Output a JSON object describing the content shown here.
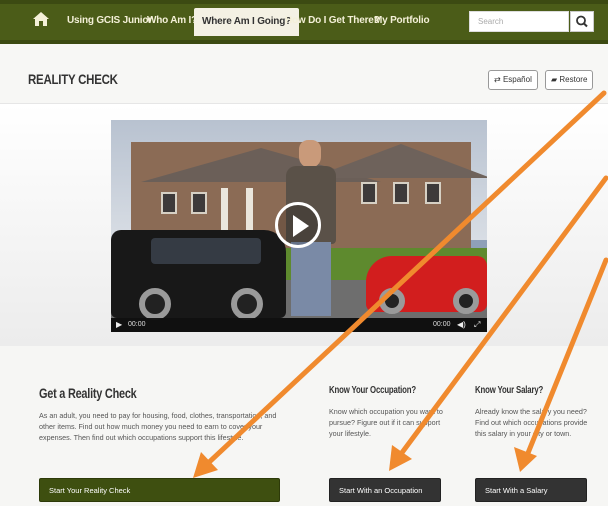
{
  "nav": {
    "items": [
      {
        "label": "Using GCIS Junior"
      },
      {
        "label": "Who Am I?"
      },
      {
        "label": "Where Am I Going?"
      },
      {
        "label": "How Do I Get There?"
      },
      {
        "label": "My Portfolio"
      }
    ],
    "active_index": 2,
    "search_placeholder": "Search"
  },
  "header": {
    "title": "REALITY CHECK",
    "espanol_label": "Español",
    "restore_label": "Restore"
  },
  "video": {
    "current_time": "00:00",
    "duration": "00:00"
  },
  "reality": {
    "heading": "Get a Reality Check",
    "body": "As an adult, you need to pay for housing, food, clothes, transportation, and other items. Find out how much money you need to earn to cover your expenses. Then find out which occupations support this lifestyle.",
    "button": "Start Your Reality Check"
  },
  "occupation": {
    "heading": "Know Your Occupation?",
    "body": "Know which occupation you want to pursue? Figure out if it can support your lifestyle.",
    "button": "Start With an Occupation"
  },
  "salary": {
    "heading": "Know Your Salary?",
    "body": "Already know the salary you need? Find out which occupations provide this salary in your city or town.",
    "button": "Start With a Salary"
  },
  "colors": {
    "nav_bg": "#4b5c18",
    "arrow": "#f08a2e",
    "primary_button": "#3e4f10",
    "dark_button": "#333333"
  },
  "icons": [
    "home-icon",
    "search-icon",
    "swap-icon",
    "book-icon",
    "play-icon",
    "volume-icon",
    "fullscreen-icon",
    "arrow-annotation"
  ]
}
